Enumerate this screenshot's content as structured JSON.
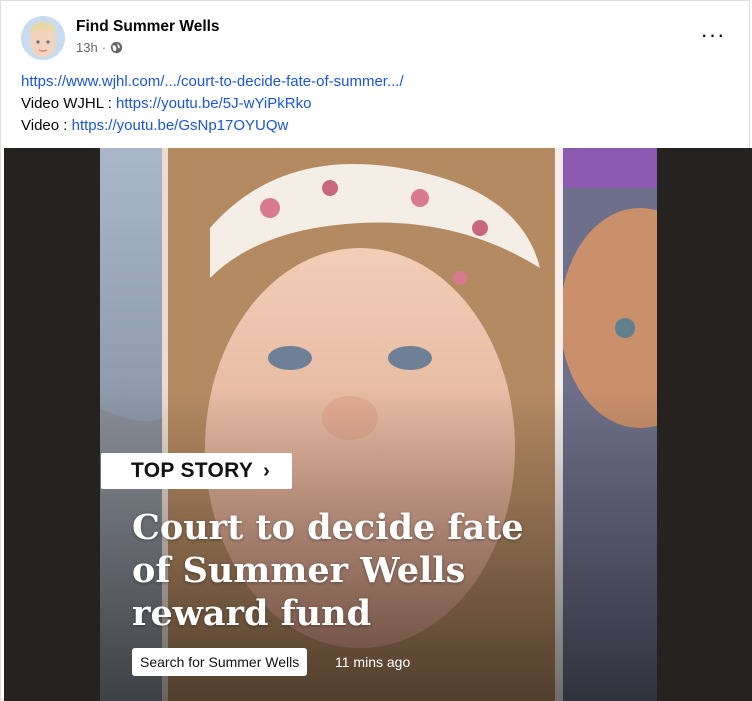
{
  "post": {
    "page_name": "Find Summer Wells",
    "time": "13h",
    "separator": "·",
    "audience_icon": "globe-icon",
    "more_icon": "more-options-icon",
    "more_label": "···",
    "lines": [
      {
        "prefix": "",
        "link": "https://www.wjhl.com/.../court-to-decide-fate-of-summer.../"
      },
      {
        "prefix": "Video WJHL : ",
        "link": "https://youtu.be/5J-wYiPkRko"
      },
      {
        "prefix": "Video : ",
        "link": "https://youtu.be/GsNp17OYUQw"
      }
    ]
  },
  "story": {
    "badge": "TOP STORY",
    "badge_chevron": "›",
    "headline": "Court to decide fate of Summer Wells reward fund",
    "search_label": "Search for Summer Wells",
    "time_ago": "11 mins ago"
  },
  "colors": {
    "link": "#1a56db",
    "media_bg": "#252220",
    "meta_text": "#65676b"
  }
}
